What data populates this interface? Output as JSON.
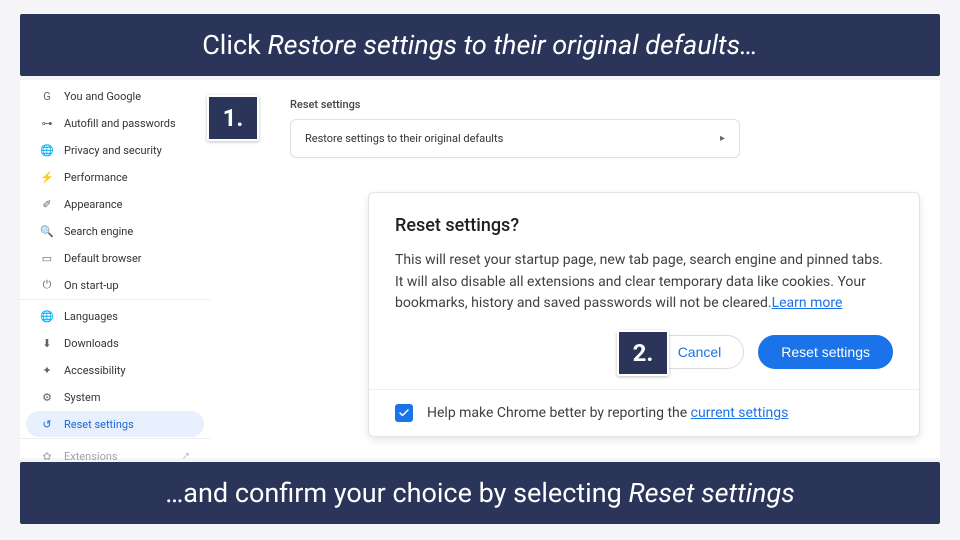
{
  "banner_top_prefix": "Click ",
  "banner_top_italic": "Restore settings to their original defaults…",
  "banner_bottom_prefix": "…and confirm your choice by selecting ",
  "banner_bottom_italic": "Reset settings",
  "badge_1": "1.",
  "badge_2": "2.",
  "sidebar": {
    "group1": [
      {
        "icon": "G",
        "label": "You and Google"
      },
      {
        "icon": "⊶",
        "label": "Autofill and passwords"
      },
      {
        "icon": "🌐",
        "label": "Privacy and security"
      },
      {
        "icon": "⚡",
        "label": "Performance"
      },
      {
        "icon": "✐",
        "label": "Appearance"
      },
      {
        "icon": "🔍",
        "label": "Search engine"
      },
      {
        "icon": "▭",
        "label": "Default browser"
      },
      {
        "icon": "⏻",
        "label": "On start-up"
      }
    ],
    "group2": [
      {
        "icon": "🌐",
        "label": "Languages"
      },
      {
        "icon": "⬇",
        "label": "Downloads"
      },
      {
        "icon": "✦",
        "label": "Accessibility"
      },
      {
        "icon": "⚙",
        "label": "System"
      },
      {
        "icon": "↺",
        "label": "Reset settings",
        "active": true
      }
    ],
    "extensions": {
      "icon": "✿",
      "label": "Extensions",
      "ext": "↗"
    }
  },
  "main": {
    "section_title": "Reset settings",
    "row_label": "Restore settings to their original defaults",
    "chev": "▸"
  },
  "dialog": {
    "title": "Reset settings?",
    "text": "This will reset your startup page, new tab page, search engine and pinned tabs. It will also disable all extensions and clear temporary data like cookies. Your bookmarks, history and saved passwords will not be cleared.",
    "learn_more": "Learn more",
    "cancel": "Cancel",
    "confirm": "Reset settings",
    "help_prefix": "Help make Chrome better by reporting the ",
    "help_link": "current settings",
    "checked": true
  }
}
